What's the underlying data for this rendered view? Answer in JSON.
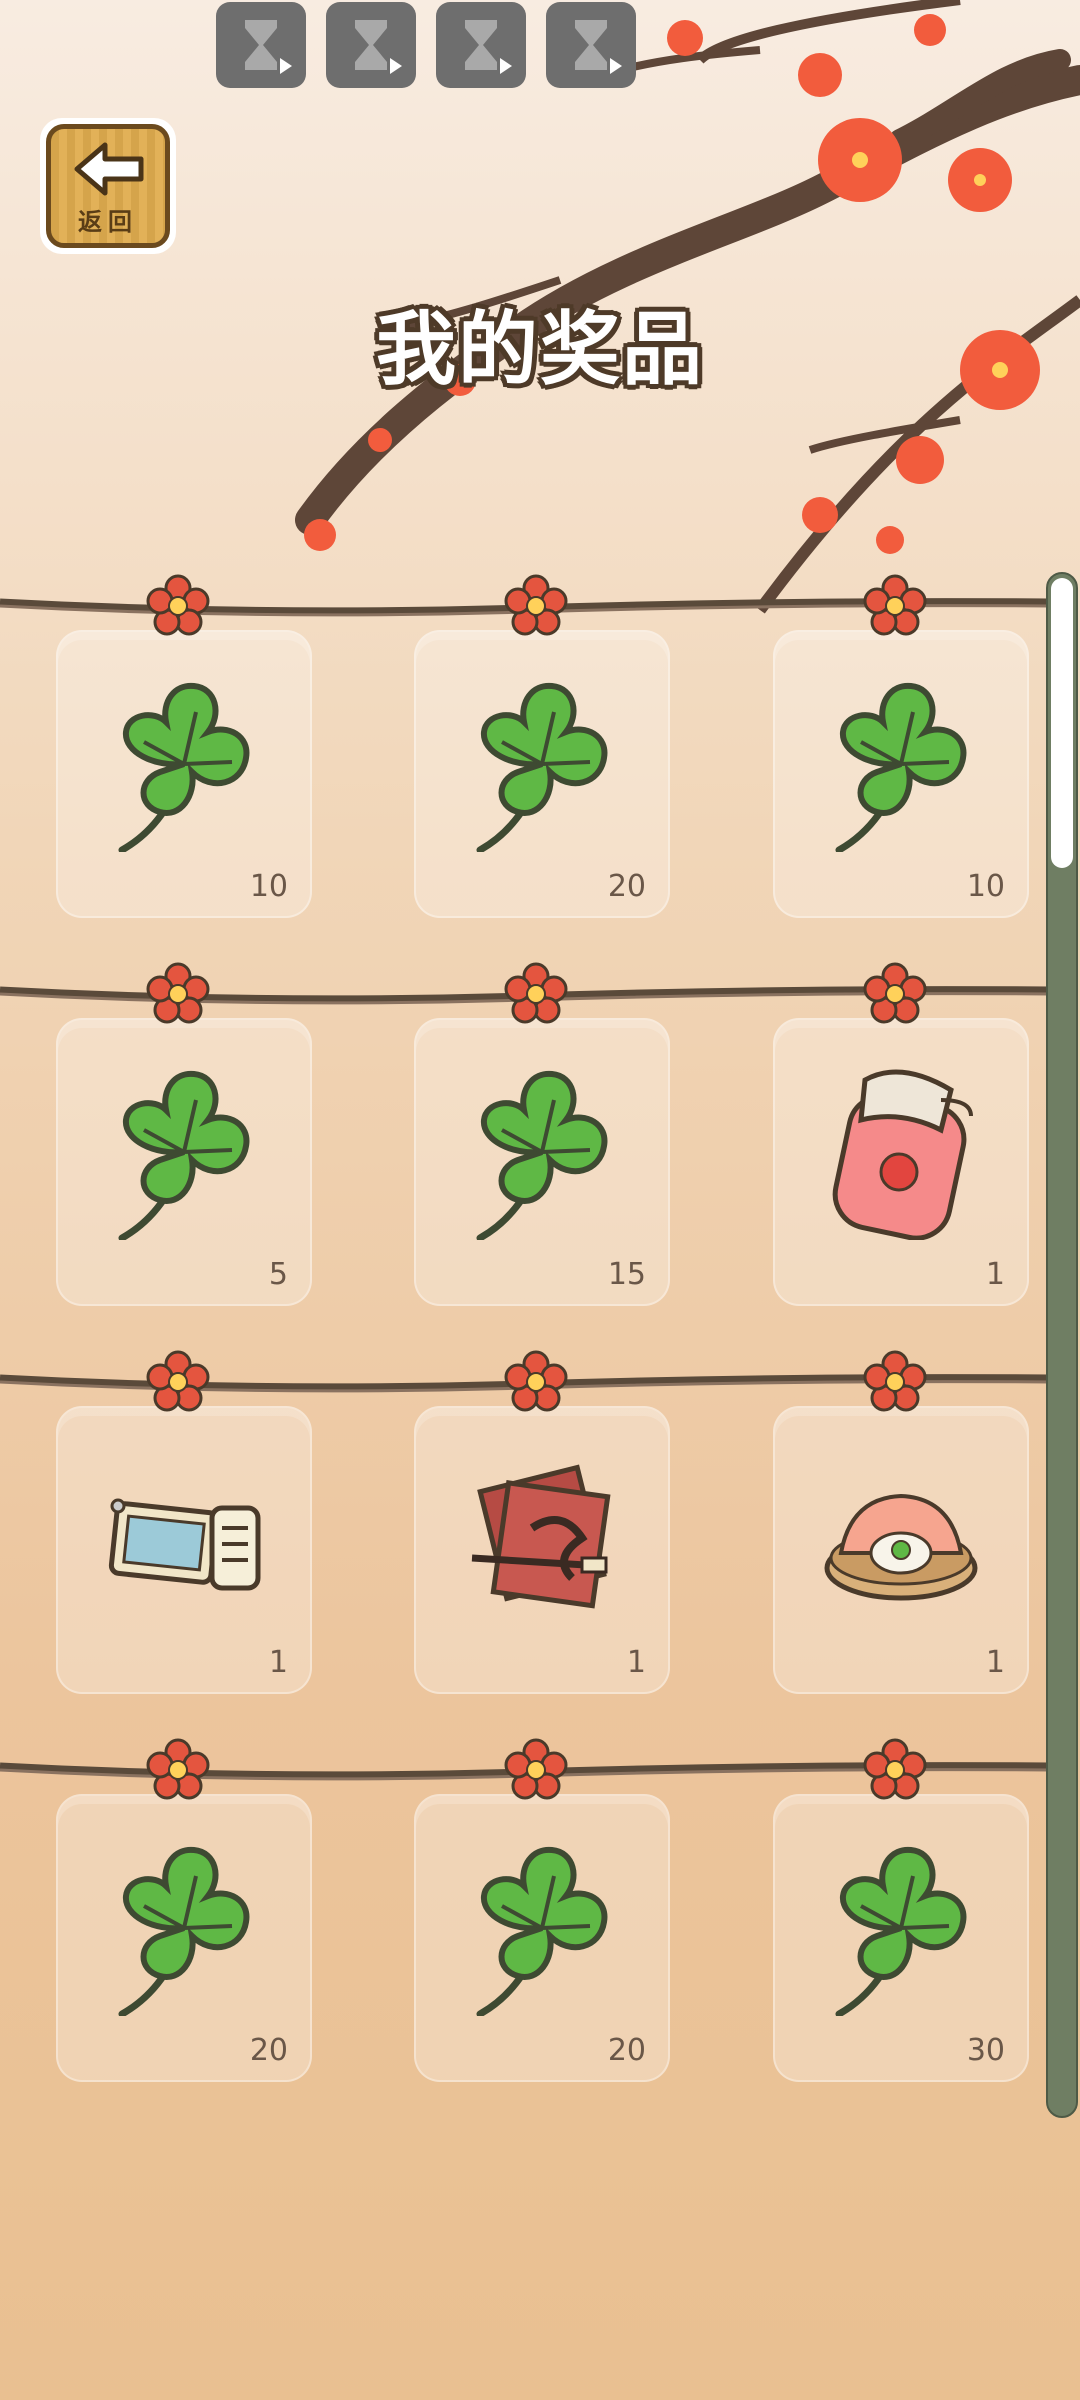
{
  "top_bar": {
    "icons": [
      "hourglass-play-icon",
      "hourglass-play-icon",
      "hourglass-play-icon",
      "hourglass-play-icon"
    ]
  },
  "back_button": {
    "label": "返回"
  },
  "title": "我的奖品",
  "colors": {
    "clover_green": "#5fb845",
    "outline": "#4a3a2a",
    "rope": "#5a4a3a",
    "flower_red": "#e4553f",
    "scroll_track": "#6f7e63"
  },
  "prizes": [
    {
      "item": "clover",
      "count": "10"
    },
    {
      "item": "clover",
      "count": "20"
    },
    {
      "item": "clover",
      "count": "10"
    },
    {
      "item": "clover",
      "count": "5"
    },
    {
      "item": "clover",
      "count": "15"
    },
    {
      "item": "strawberry-jam",
      "count": "1"
    },
    {
      "item": "tag-ticket",
      "count": "1"
    },
    {
      "item": "calligraphy-paper",
      "count": "1"
    },
    {
      "item": "shrimp-dish",
      "count": "1"
    },
    {
      "item": "clover",
      "count": "20"
    },
    {
      "item": "clover",
      "count": "20"
    },
    {
      "item": "clover",
      "count": "30"
    }
  ]
}
